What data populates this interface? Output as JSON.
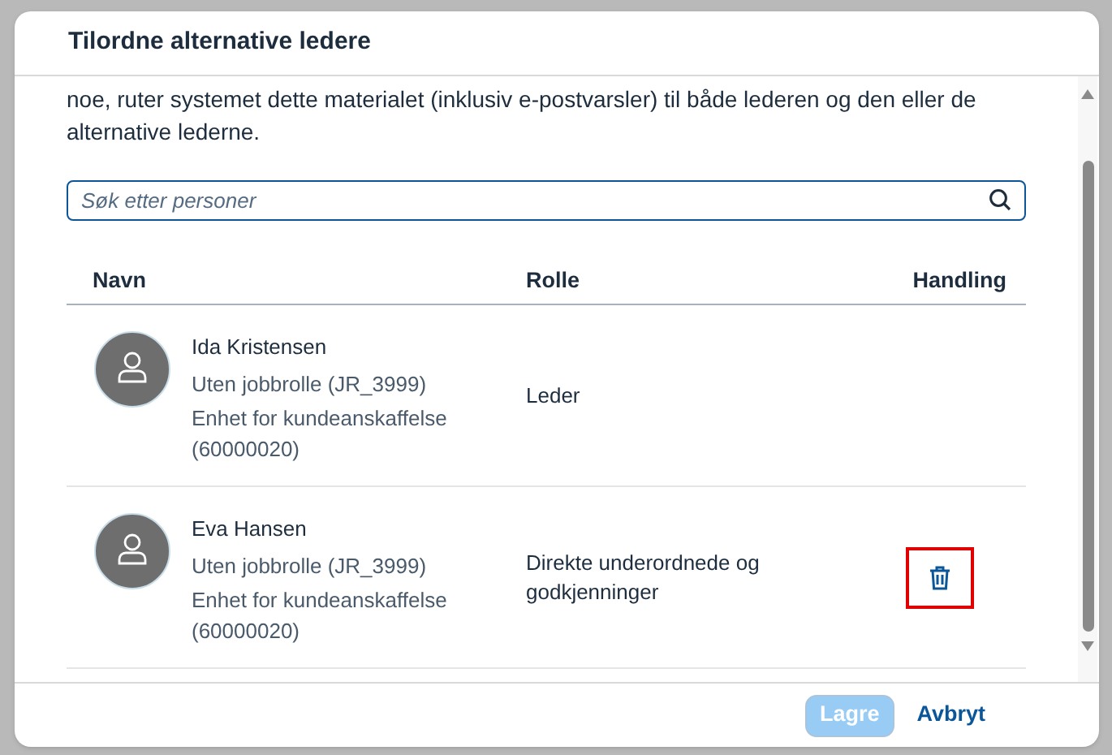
{
  "dialog": {
    "title": "Tilordne alternative ledere",
    "description": "noe, ruter systemet dette materialet (inklusiv e-postvarsler) til både lederen og den eller de alternative lederne.",
    "search": {
      "placeholder": "Søk etter personer"
    },
    "table": {
      "columns": [
        "Navn",
        "Rolle",
        "Handling"
      ],
      "rows": [
        {
          "name": "Ida Kristensen",
          "job": "Uten jobbrolle (JR_3999)",
          "unit": "Enhet for kundeanskaffelse (60000020)",
          "role": "Leder",
          "deletable": false
        },
        {
          "name": "Eva Hansen",
          "job": "Uten jobbrolle (JR_3999)",
          "unit": "Enhet for kundeanskaffelse (60000020)",
          "role": "Direkte underordnede og godkjenninger",
          "deletable": true,
          "highlighted": true
        }
      ]
    },
    "buttons": [
      {
        "label": "Lagre",
        "kind": "primary",
        "disabled": true
      },
      {
        "label": "Avbryt",
        "kind": "link",
        "disabled": false
      }
    ]
  }
}
